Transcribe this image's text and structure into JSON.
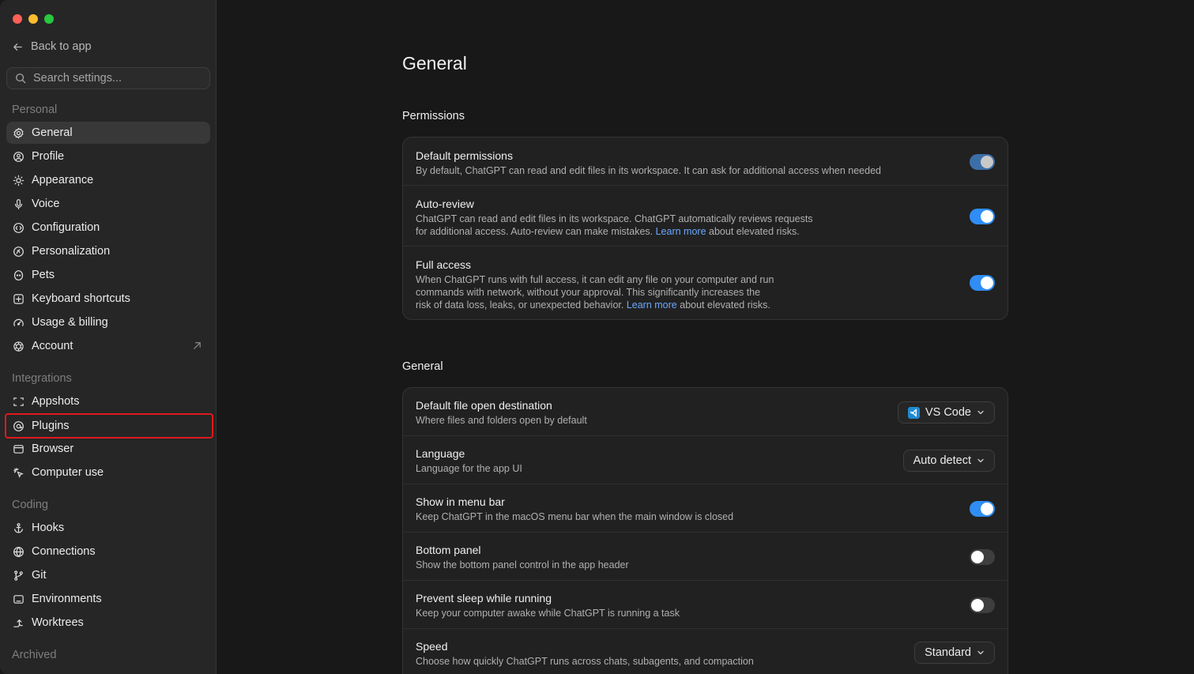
{
  "sidebar": {
    "back_label": "Back to app",
    "search_placeholder": "Search settings...",
    "groups": {
      "personal": "Personal",
      "integrations": "Integrations",
      "coding": "Coding",
      "archived": "Archived"
    },
    "items": {
      "general": "General",
      "profile": "Profile",
      "appearance": "Appearance",
      "voice": "Voice",
      "configuration": "Configuration",
      "personalization": "Personalization",
      "pets": "Pets",
      "keyboard_shortcuts": "Keyboard shortcuts",
      "usage_billing": "Usage & billing",
      "account": "Account",
      "appshots": "Appshots",
      "plugins": "Plugins",
      "browser": "Browser",
      "computer_use": "Computer use",
      "hooks": "Hooks",
      "connections": "Connections",
      "git": "Git",
      "environments": "Environments",
      "worktrees": "Worktrees"
    }
  },
  "main": {
    "title": "General",
    "permissions": {
      "heading": "Permissions",
      "default": {
        "title": "Default permissions",
        "desc": "By default, ChatGPT can read and edit files in its workspace. It can ask for additional access when needed",
        "state": "on-disabled"
      },
      "auto_review": {
        "title": "Auto-review",
        "desc_1": "ChatGPT can read and edit files in its workspace. ChatGPT automatically reviews requests",
        "desc_2_pre": "for additional access. Auto-review can make mistakes. ",
        "link": "Learn more",
        "desc_2_post": " about elevated risks.",
        "state": "on"
      },
      "full_access": {
        "title": "Full access",
        "desc_1": "When ChatGPT runs with full access, it can edit any file on your computer and run",
        "desc_2": "commands with network, without your approval. This significantly increases the",
        "desc_3_pre": "risk of data loss, leaks, or unexpected behavior. ",
        "link": "Learn more",
        "desc_3_post": " about elevated risks.",
        "state": "on"
      }
    },
    "general": {
      "heading": "General",
      "file_open": {
        "title": "Default file open destination",
        "desc": "Where files and folders open by default",
        "value": "VS Code"
      },
      "language": {
        "title": "Language",
        "desc": "Language for the app UI",
        "value": "Auto detect"
      },
      "menu_bar": {
        "title": "Show in menu bar",
        "desc": "Keep ChatGPT in the macOS menu bar when the main window is closed",
        "state": "on"
      },
      "bottom_panel": {
        "title": "Bottom panel",
        "desc": "Show the bottom panel control in the app header",
        "state": "off"
      },
      "prevent_sleep": {
        "title": "Prevent sleep while running",
        "desc": "Keep your computer awake while ChatGPT is running a task",
        "state": "off"
      },
      "speed": {
        "title": "Speed",
        "desc": "Choose how quickly ChatGPT runs across chats, subagents, and compaction",
        "value": "Standard"
      }
    }
  }
}
